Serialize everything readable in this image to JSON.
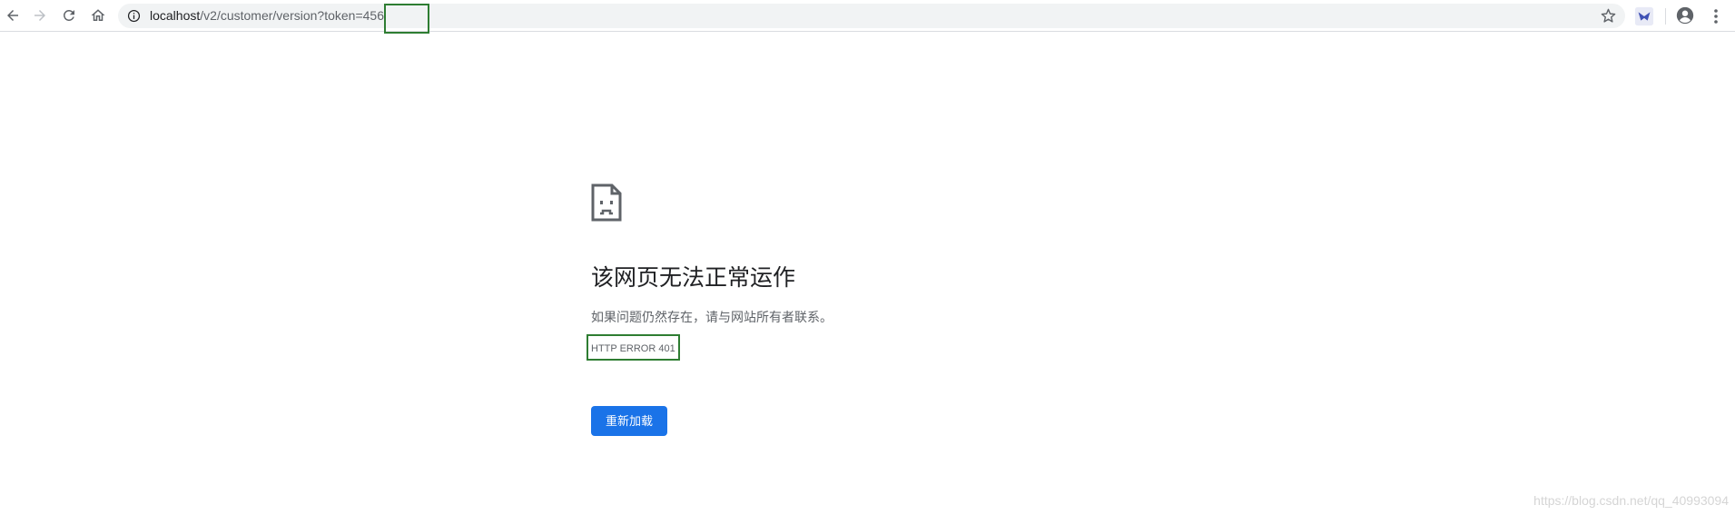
{
  "browser": {
    "url": {
      "host": "localhost",
      "path": "/v2/customer/version?token=",
      "token_value": "456"
    },
    "icons": {
      "back": "back-arrow-icon",
      "forward": "forward-arrow-icon",
      "reload": "reload-icon",
      "home": "home-icon",
      "site_info": "info-icon",
      "bookmark": "star-icon",
      "extension": "extension-icon",
      "profile": "account-circle-icon",
      "menu": "more-vertical-icon"
    }
  },
  "error_page": {
    "icon": "sad-page-icon",
    "title": "该网页无法正常运作",
    "description": "如果问题仍然存在，请与网站所有者联系。",
    "error_code": "HTTP ERROR 401",
    "reload_label": "重新加载"
  },
  "watermark": "https://blog.csdn.net/qq_40993094",
  "colors": {
    "accent": "#1a73e8",
    "highlight_box": "#2e7d32",
    "title_text": "#202124",
    "secondary_text": "#5f6368"
  }
}
